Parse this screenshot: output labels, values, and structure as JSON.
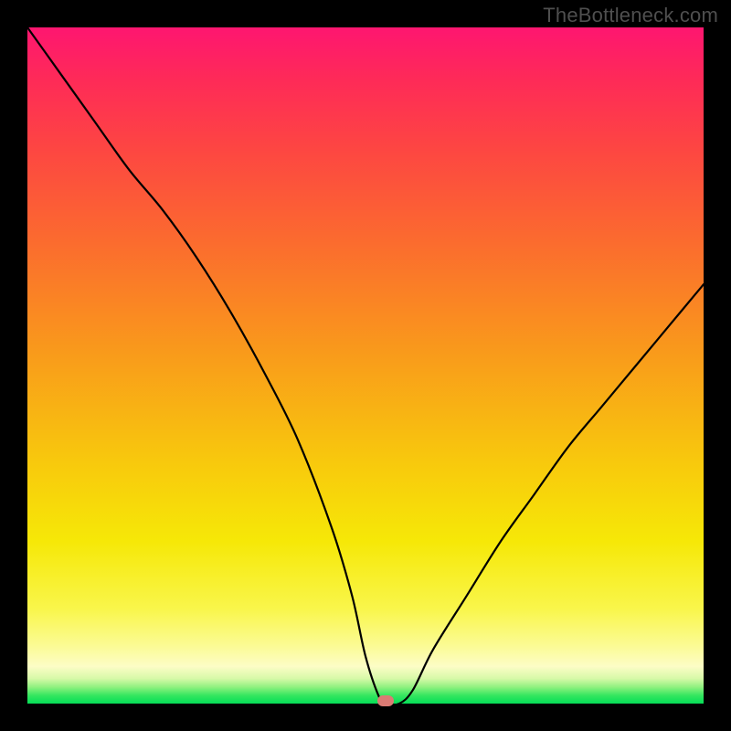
{
  "watermark": "TheBottleneck.com",
  "colors": {
    "frame": "#000000",
    "watermark_text": "#4f4f4f",
    "curve": "#000000",
    "marker": "#db7b74",
    "gradient_stops": [
      "#fe1670",
      "#fe2b57",
      "#fd4642",
      "#fb6c2e",
      "#f99a1b",
      "#f8c80d",
      "#f6e807",
      "#f9f64b",
      "#fbfb95",
      "#fcfdc6",
      "#d7f9a8",
      "#8df17e",
      "#35e65f",
      "#05de57"
    ]
  },
  "chart_data": {
    "type": "line",
    "title": "",
    "xlabel": "",
    "ylabel": "",
    "xlim": [
      0,
      100
    ],
    "ylim": [
      0,
      100
    ],
    "series": [
      {
        "name": "bottleneck-curve",
        "x": [
          0,
          5,
          10,
          15,
          20,
          25,
          30,
          35,
          40,
          45,
          48,
          50,
          52,
          53,
          55,
          57,
          60,
          65,
          70,
          75,
          80,
          85,
          90,
          95,
          100
        ],
        "y": [
          100,
          93,
          86,
          79,
          73,
          66,
          58,
          49,
          39,
          26,
          16,
          7,
          1,
          0,
          0,
          2,
          8,
          16,
          24,
          31,
          38,
          44,
          50,
          56,
          62
        ]
      }
    ],
    "marker": {
      "x": 53,
      "y": 0,
      "color": "#db7b74"
    },
    "background_meaning": "gradient encodes bottleneck severity: red high, green zero"
  }
}
